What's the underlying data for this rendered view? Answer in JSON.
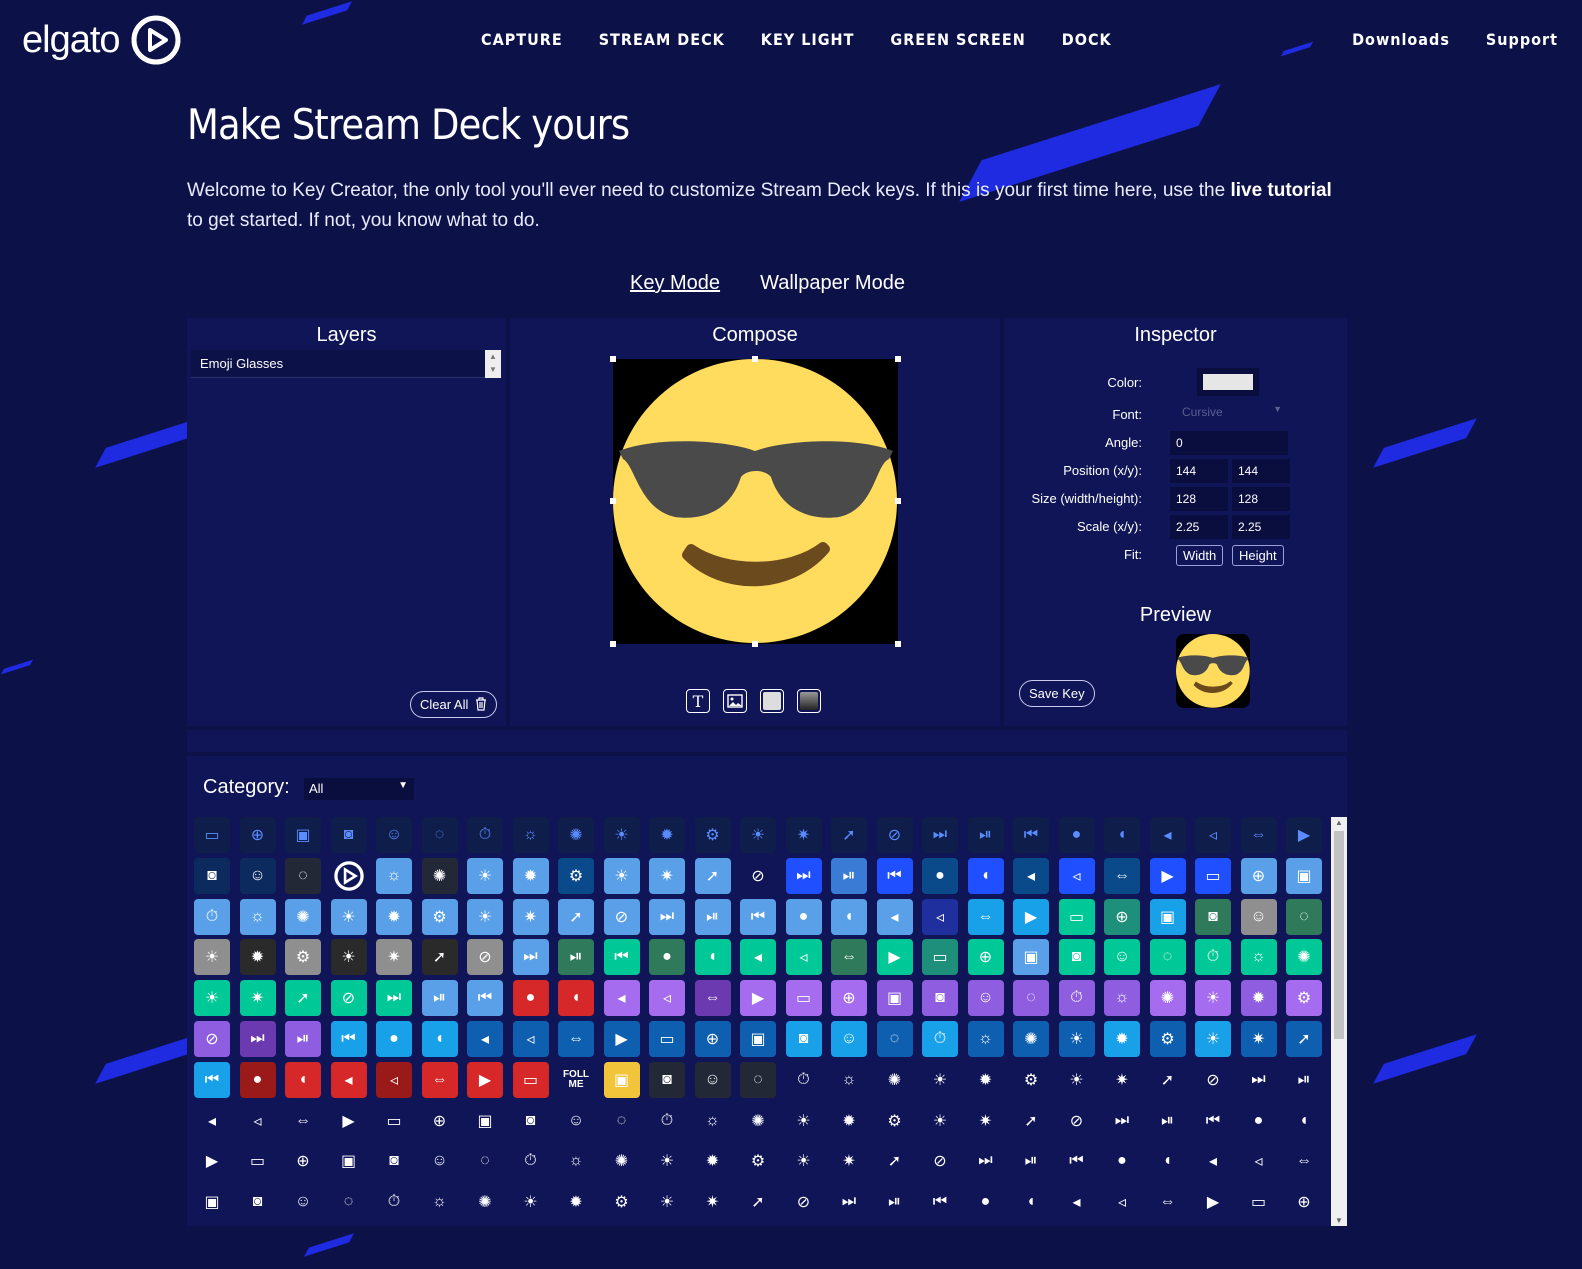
{
  "header": {
    "logo_text": "elgato",
    "nav": [
      "CAPTURE",
      "STREAM DECK",
      "KEY LIGHT",
      "GREEN SCREEN",
      "DOCK"
    ],
    "nav_right": [
      "Downloads",
      "Support"
    ]
  },
  "page": {
    "title": "Make Stream Deck yours",
    "intro_before": "Welcome to Key Creator, the only tool you'll ever need to customize Stream Deck keys. If this is your first time here, use the ",
    "intro_link": "live tutorial",
    "intro_after": " to get started. If not, you know what to do."
  },
  "modes": {
    "key": "Key Mode",
    "wallpaper": "Wallpaper Mode",
    "active": "key"
  },
  "layers": {
    "title": "Layers",
    "items": [
      "Emoji Glasses"
    ],
    "clear_all": "Clear All"
  },
  "compose": {
    "title": "Compose"
  },
  "inspector": {
    "title": "Inspector",
    "color_label": "Color:",
    "color_value": "#e6e6e6",
    "font_label": "Font:",
    "font_value": "Cursive",
    "angle_label": "Angle:",
    "angle_value": "0",
    "position_label": "Position (x/y):",
    "position_x": "144",
    "position_y": "144",
    "size_label": "Size (width/height):",
    "size_w": "128",
    "size_h": "128",
    "scale_label": "Scale (x/y):",
    "scale_x": "2.25",
    "scale_y": "2.25",
    "fit_label": "Fit:",
    "fit_width": "Width",
    "fit_height": "Height",
    "preview_title": "Preview",
    "save_key": "Save Key"
  },
  "library": {
    "category_label": "Category:",
    "category_value": "All",
    "follow_me_line1": "FOLL",
    "follow_me_line2": "ME"
  },
  "colors": {
    "background": "#0c1148",
    "panel": "#0f1556",
    "accent_blue": "#1f2be0",
    "emoji_yellow": "#ffdb5e",
    "glasses": "#4a4a4a",
    "smile": "#6b4a1e"
  },
  "key_palette": [
    "#0d2a5e",
    "#3a7bd5",
    "#0a4a8a",
    "#1f4fff",
    "#5aa0e8",
    "#1f2f9e",
    "#8f8f8f",
    "#2a2a2a",
    "#2f7a5a",
    "#00c896",
    "#18d0a8",
    "#1e8f7a",
    "#8e5de0",
    "#a56cf0",
    "#6b3ab0",
    "#18a0e8",
    "#0f5fb0",
    "#d62828",
    "#9a1a1a",
    "#f2c43a",
    "#0f1556",
    "#222836"
  ]
}
